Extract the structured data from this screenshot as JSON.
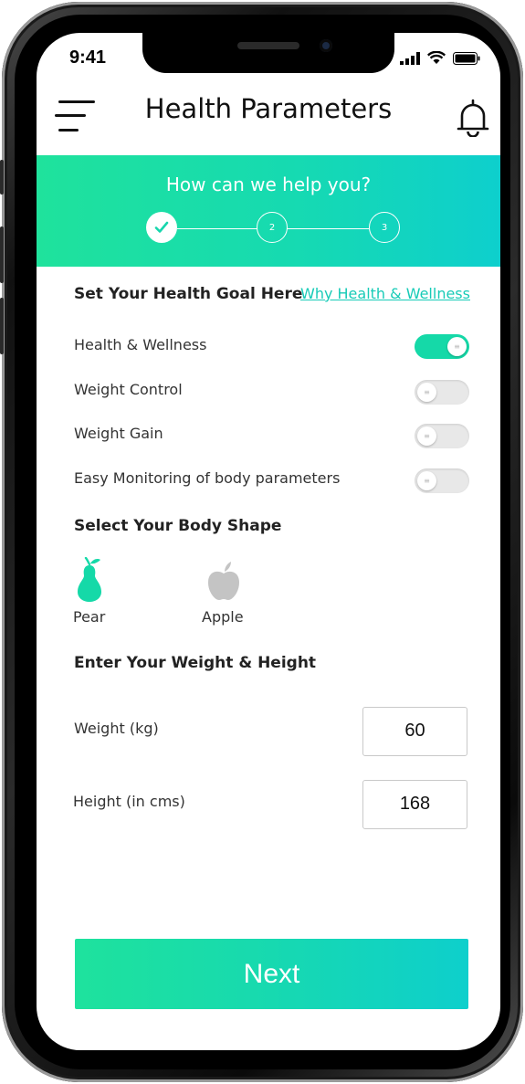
{
  "status_bar": {
    "time": "9:41"
  },
  "header": {
    "title": "Health Parameters",
    "menu_icon": "hamburger-menu-icon",
    "bell_icon": "bell-icon"
  },
  "banner": {
    "title": "How can we help you?",
    "steps": [
      {
        "label": "",
        "state": "done",
        "icon": "check-icon"
      },
      {
        "label": "2",
        "state": "pending"
      },
      {
        "label": "3",
        "state": "pending"
      }
    ],
    "gradient": [
      "#1fe29c",
      "#0ecfcd"
    ]
  },
  "goal": {
    "heading": "Set Your Health Goal Here",
    "link": "Why Health & Wellness",
    "options": [
      {
        "label": "Health & Wellness",
        "on": true
      },
      {
        "label": "Weight Control",
        "on": false
      },
      {
        "label": "Weight Gain",
        "on": false
      },
      {
        "label": "Easy Monitoring of body parameters",
        "on": false
      }
    ]
  },
  "body_shape": {
    "heading": "Select Your Body Shape",
    "options": [
      {
        "label": "Pear",
        "icon": "pear-icon",
        "selected": true
      },
      {
        "label": "Apple",
        "icon": "apple-icon",
        "selected": false
      }
    ]
  },
  "measurements": {
    "heading": "Enter Your Weight & Height",
    "weight": {
      "label": "Weight (kg)",
      "value": "60"
    },
    "height": {
      "label": "Height (in cms)",
      "value": "168"
    }
  },
  "next_label": "Next",
  "colors": {
    "accent": "#15d9a8",
    "link": "#17cbb7",
    "inactive_icon": "#c4c4c4"
  }
}
